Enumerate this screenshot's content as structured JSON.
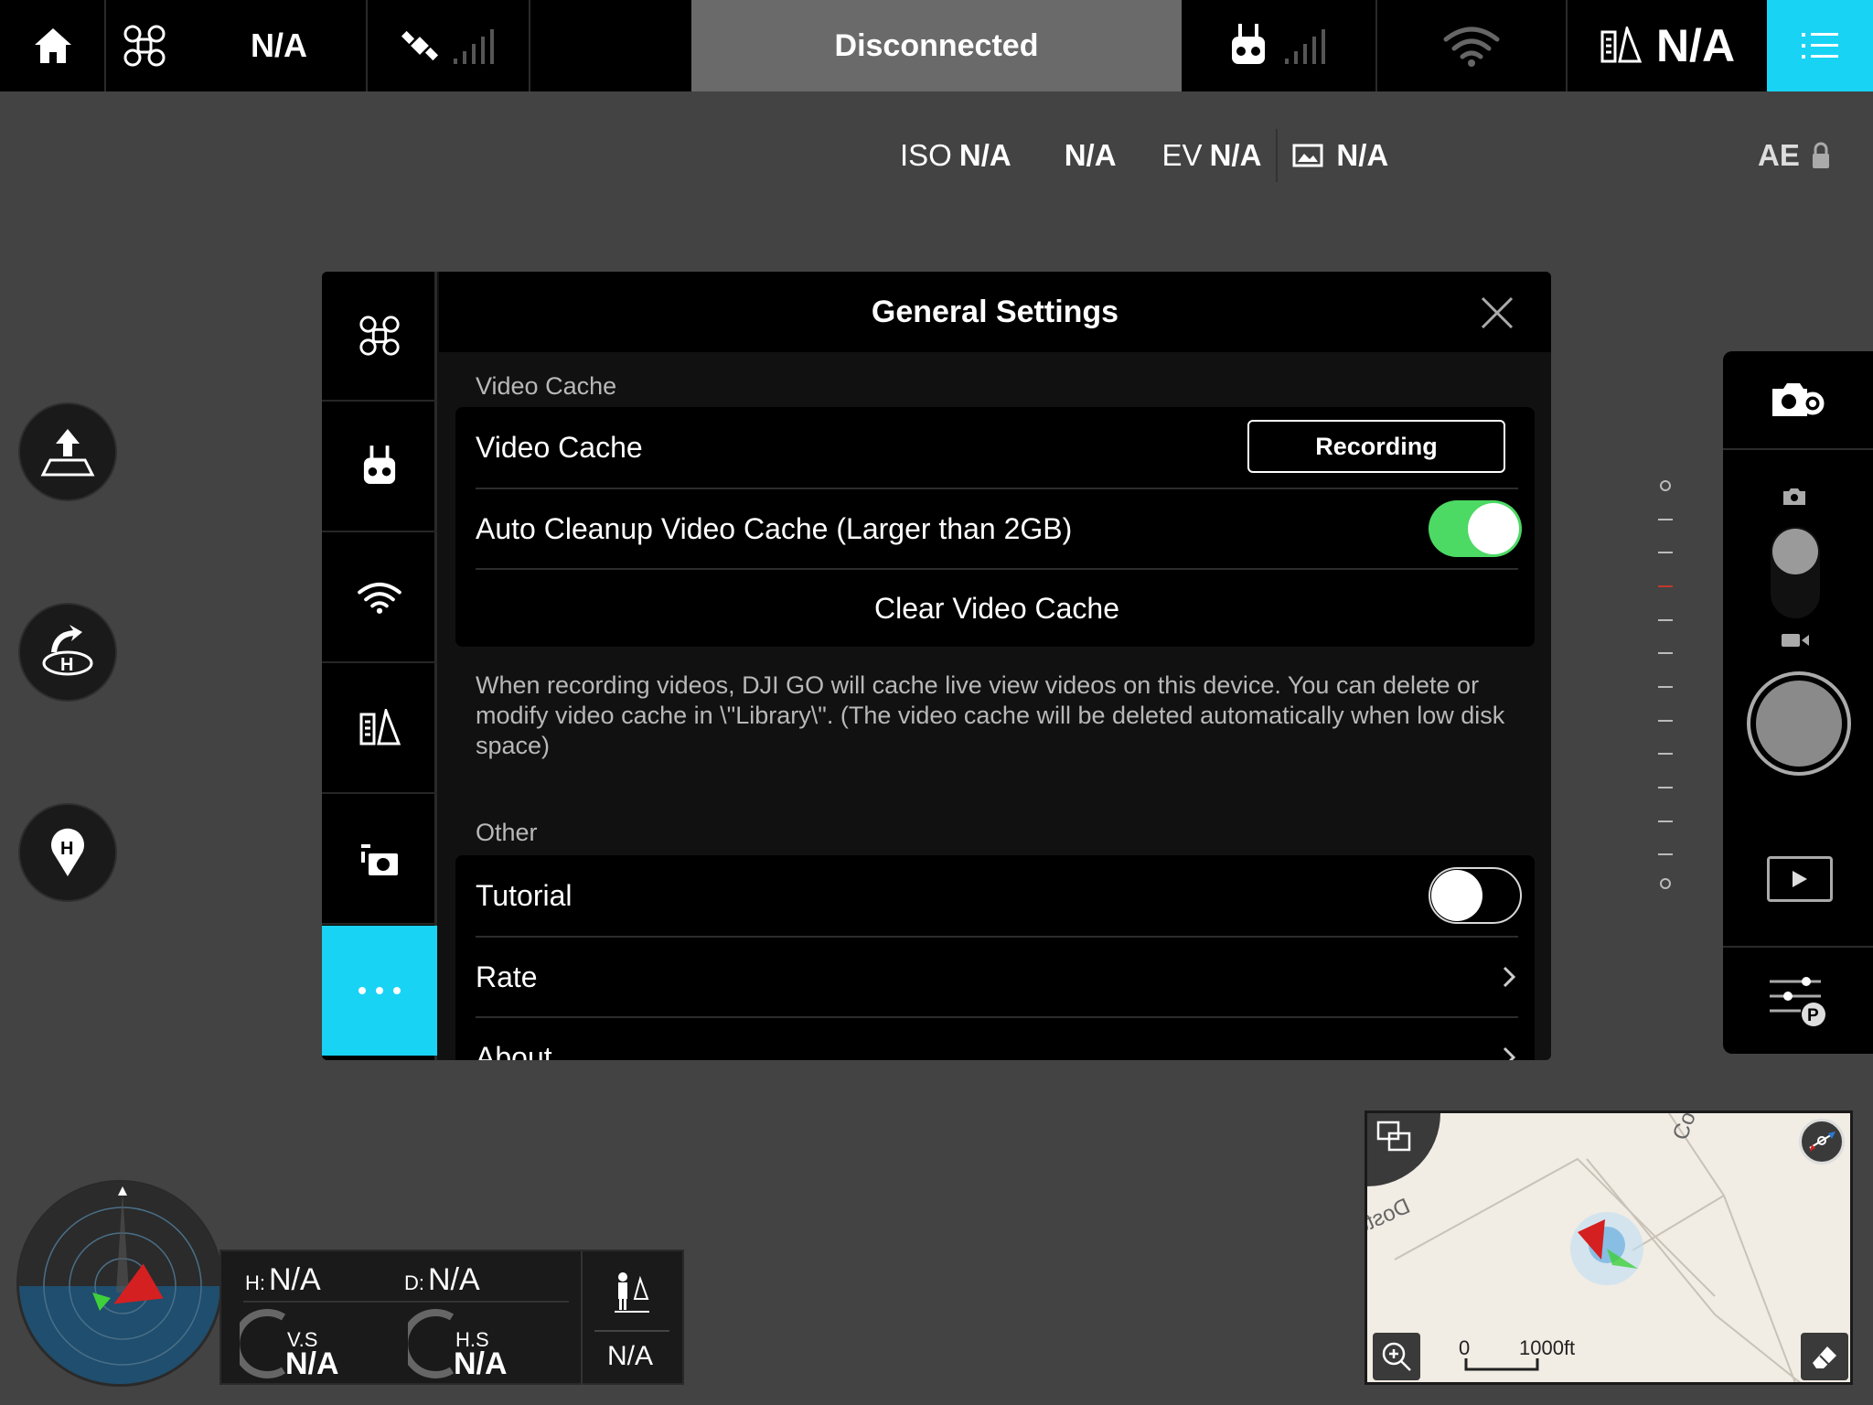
{
  "topbar": {
    "aircraft_mode": "N/A",
    "status": "Disconnected",
    "battery": "N/A"
  },
  "camera_params": {
    "iso_label": "ISO",
    "iso": "N/A",
    "shutter": "N/A",
    "ev_label": "EV",
    "ev": "N/A",
    "format": "N/A",
    "ae": "AE"
  },
  "dialog": {
    "title": "General Settings",
    "video_cache_section": "Video Cache",
    "video_cache_label": "Video Cache",
    "video_cache_button": "Recording",
    "auto_cleanup_label": "Auto Cleanup Video Cache (Larger than 2GB)",
    "auto_cleanup_on": true,
    "clear_cache_label": "Clear Video Cache",
    "note": "When recording videos, DJI GO will cache live view videos on this device. You can delete or modify video cache in \\\"Library\\\". (The video cache will be deleted automatically when low disk space)",
    "other_section": "Other",
    "tutorial_label": "Tutorial",
    "tutorial_on": false,
    "rate_label": "Rate",
    "about_label": "About",
    "sidebar": [
      "aircraft-icon",
      "remote-controller-icon",
      "wifi-icon",
      "checklist-icon",
      "gimbal-camera-icon",
      "more-icon"
    ]
  },
  "telemetry": {
    "h_label": "H:",
    "h": "N/A",
    "d_label": "D:",
    "d": "N/A",
    "vs_label": "V.S",
    "vs": "N/A",
    "hs_label": "H.S",
    "hs": "N/A",
    "home_dist": "N/A"
  },
  "map": {
    "road": "Doster Rd",
    "scale_start": "0",
    "scale_end": "1000ft",
    "corner_label": "Co"
  },
  "colors": {
    "accent": "#19d3f5",
    "toggle_on": "#4cd964",
    "status_bg": "#6a6a6a"
  }
}
